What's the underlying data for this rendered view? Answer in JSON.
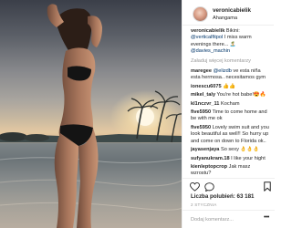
{
  "post": {
    "author": "veronicabielik",
    "separator": "•",
    "follow_label": "",
    "location": "Ahangama"
  },
  "caption": {
    "username": "veronicabielik",
    "text_1": "Bikini: ",
    "mention_1": "@verticalfitpol",
    "text_2": " I miss warm evenings there... ",
    "emoji": "🏝️",
    "mention_2": "@davies_machin"
  },
  "load_more_label": "Załaduj więcej komentarzy",
  "comments": [
    {
      "username": "maregee",
      "mention": "@elizdb",
      "text": " ve esta niña esta hermosa.. necesitamos gym"
    },
    {
      "username": "ionescu6075",
      "mention": "",
      "text": " 👍👍"
    },
    {
      "username": "mikel_taly",
      "mention": "",
      "text": " You're hot babe!😍🔥"
    },
    {
      "username": "kl1nczvr_11",
      "mention": "",
      "text": " Kocham"
    },
    {
      "username": "five5950",
      "mention": "",
      "text": " Time to come home and be with me ok"
    },
    {
      "username": "five5950",
      "mention": "",
      "text": " Lovely swim suit and you look beautiful as well!! So hurry up and come on down to Florida ok.."
    },
    {
      "username": "jayasenjaya",
      "mention": "",
      "text": " So sexy 👌👌👌"
    },
    {
      "username": "sufyanukram.18",
      "mention": "",
      "text": " I like your hight"
    },
    {
      "username": "kienleptopcrop",
      "mention": "",
      "text": " Jak masz wzrostu?"
    }
  ],
  "actions": {
    "like_icon": "heart-icon",
    "comment_icon": "comment-bubble-icon",
    "save_icon": "bookmark-icon"
  },
  "likes": {
    "label": "Liczba polubień: ",
    "count": "63 181"
  },
  "date": "2 STYCZNIA",
  "add_comment": {
    "placeholder": "Dodaj komentarz...",
    "more_label": "•••"
  },
  "colors": {
    "link_blue": "#3897f0",
    "text": "#262626",
    "muted": "#999999",
    "border": "#efefef"
  }
}
